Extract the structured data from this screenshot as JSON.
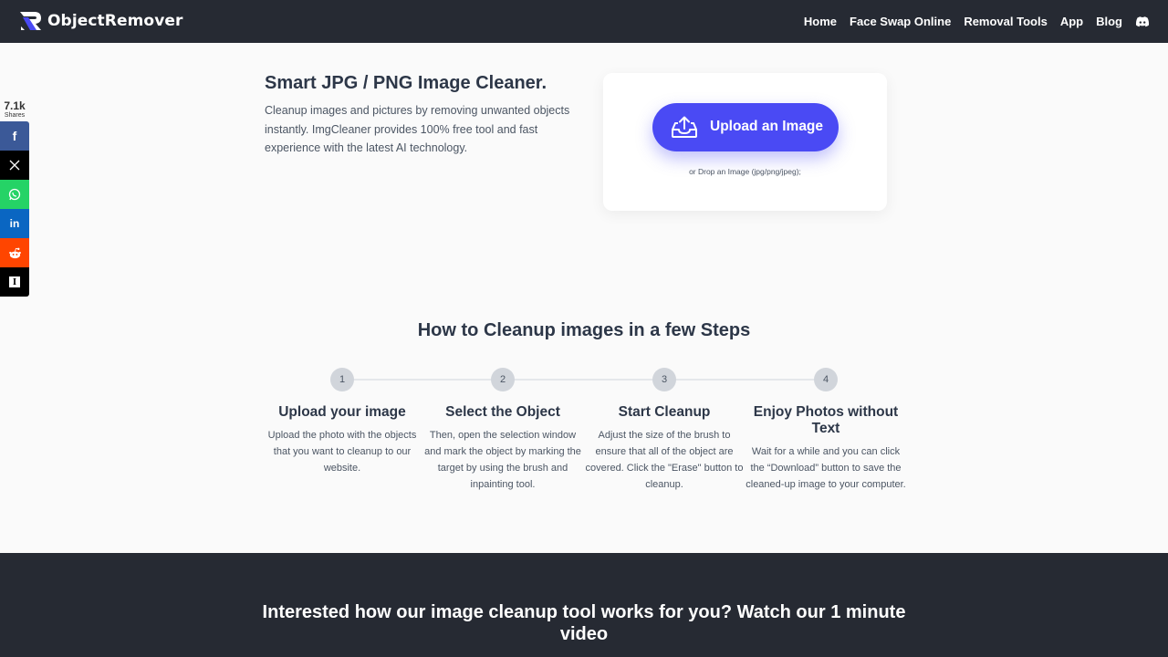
{
  "header": {
    "brand": "ObjectRemover",
    "nav": [
      {
        "label": "Home"
      },
      {
        "label": "Face Swap Online"
      },
      {
        "label": "Removal Tools"
      },
      {
        "label": "App"
      },
      {
        "label": "Blog"
      }
    ],
    "discord_icon": "discord-icon"
  },
  "share": {
    "count": "7.1k",
    "label": "Shares",
    "buttons": [
      {
        "name": "facebook",
        "glyph": "f",
        "color": "#3b5998"
      },
      {
        "name": "x",
        "glyph": "𝕏",
        "color": "#000000"
      },
      {
        "name": "whatsapp",
        "glyph": "✆",
        "color": "#25d366"
      },
      {
        "name": "linkedin",
        "glyph": "in",
        "color": "#0a66c2"
      },
      {
        "name": "reddit",
        "glyph": "👽",
        "color": "#ff4500"
      },
      {
        "name": "instapaper",
        "glyph": "I",
        "color": "#000000"
      }
    ]
  },
  "hero": {
    "title": "Smart JPG / PNG Image Cleaner.",
    "description": "Cleanup images and pictures by removing unwanted objects instantly. ImgCleaner provides 100% free tool and fast experience with the latest AI technology.",
    "upload_button": "Upload an Image",
    "drop_hint": "or Drop an Image (jpg/png/jpeg);",
    "accent_color": "#4a4af4"
  },
  "steps": {
    "title": "How to Cleanup images in a few Steps",
    "items": [
      {
        "num": "1",
        "title": "Upload your image",
        "text": "Upload the photo with the objects that you want to cleanup to our website."
      },
      {
        "num": "2",
        "title": "Select the Object",
        "text": "Then, open the selection window and mark the object by marking the target by using the brush and inpainting tool."
      },
      {
        "num": "3",
        "title": "Start Cleanup",
        "text": "Adjust the size of the brush to ensure that all of the object are covered. Click the \"Erase\" button to cleanup."
      },
      {
        "num": "4",
        "title": "Enjoy Photos without Text",
        "text": "Wait for a while and you can click the “Download” button to save the cleaned-up image to your computer."
      }
    ]
  },
  "video_section": {
    "title": "Interested how our image cleanup tool works for you? Watch our 1 minute video"
  }
}
